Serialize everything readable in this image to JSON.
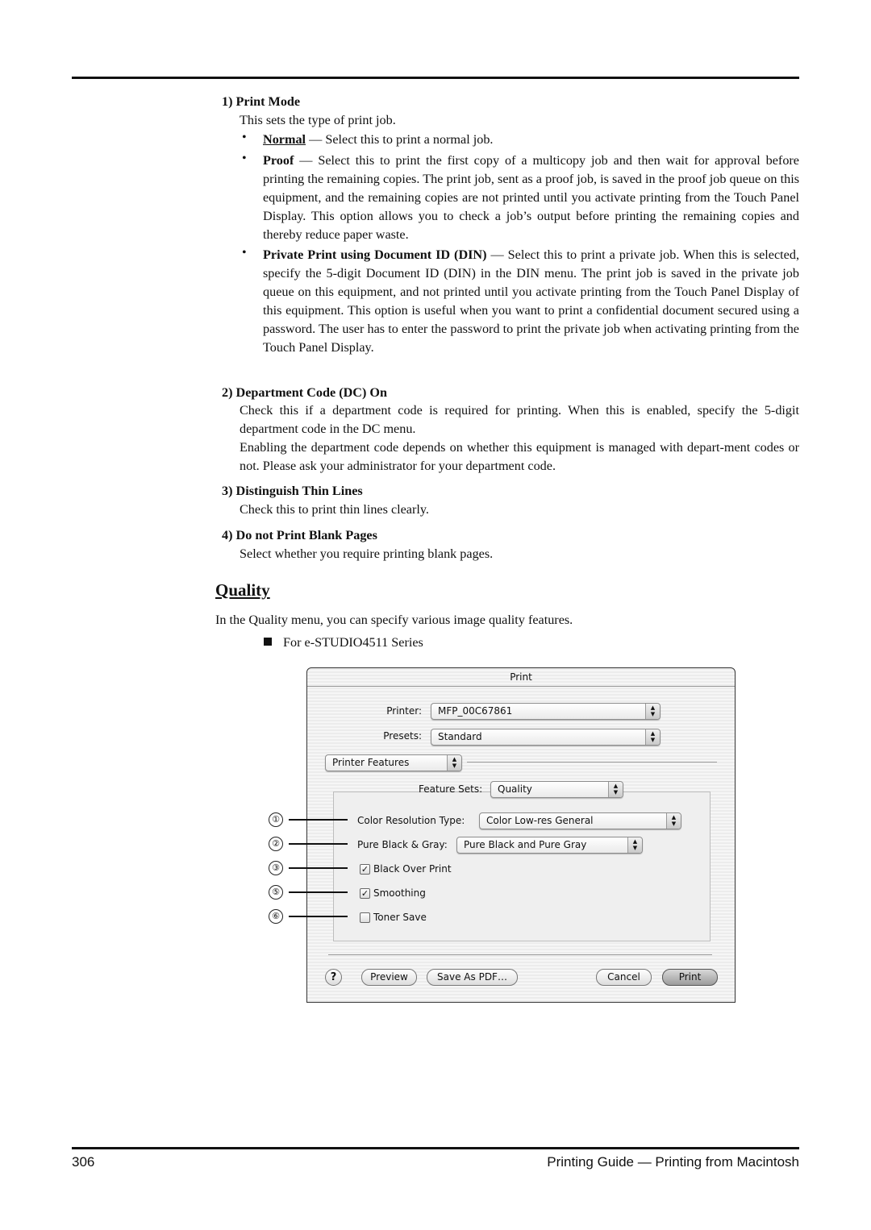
{
  "sections": [
    {
      "heading": "1) Print Mode",
      "intro": "This sets the type of print job.",
      "bullets": [
        {
          "term": "Normal",
          "text": " — Select this to print a normal job."
        },
        {
          "term": "Proof",
          "text": " — Select this to print the first copy of a multicopy job and then wait for approval before printing the remaining copies.  The print job, sent as a proof job, is saved in the proof job queue on this equipment, and the remaining copies are not printed until you activate printing from the Touch Panel Display.  This option allows you to check a job’s output before printing the remaining copies and thereby reduce paper waste."
        },
        {
          "term": "Private Print using Document ID (DIN)",
          "text": " — Select this to print a private job.   When this is selected, specify the 5-digit Document ID (DIN) in the DIN menu.  The print job is saved in the private job queue on this equipment, and not printed until you activate printing from the Touch Panel Display of this equipment.  This option is useful when you want to print a confidential document secured using a password.  The user has to enter the password to print the private job when activating printing from the Touch Panel Display."
        }
      ]
    },
    {
      "heading": "2) Department Code (DC) On",
      "paragraphs": [
        "Check this if a department code is required for printing. When this is enabled, specify the 5-digit department code in the DC menu.",
        "Enabling the department code depends on whether this equipment is managed with depart-ment codes or not.  Please ask your administrator for your department code."
      ]
    },
    {
      "heading": "3) Distinguish Thin Lines",
      "paragraphs": [
        "Check this to print thin lines clearly."
      ]
    },
    {
      "heading": "4) Do not Print Blank Pages",
      "paragraphs": [
        "Select whether you require printing blank pages."
      ]
    }
  ],
  "quality": {
    "title": "Quality",
    "intro": "In the Quality menu, you can specify various image quality features.",
    "series_note": "For e-STUDIO4511 Series"
  },
  "dialog": {
    "title": "Print",
    "printer_label": "Printer:",
    "printer_value": "MFP_00C67861",
    "presets_label": "Presets:",
    "presets_value": "Standard",
    "panel_value": "Printer Features",
    "feature_sets_label": "Feature Sets:",
    "feature_sets_value": "Quality",
    "color_resolution_label": "Color Resolution Type:",
    "color_resolution_value": "Color Low-res General",
    "pure_black_label": "Pure Black & Gray:",
    "pure_black_value": "Pure Black and Pure Gray",
    "checkboxes": [
      {
        "label": "Black Over Print",
        "checked": true
      },
      {
        "label": "Smoothing",
        "checked": true
      },
      {
        "label": "Toner Save",
        "checked": false
      }
    ],
    "help_glyph": "?",
    "buttons": {
      "preview": "Preview",
      "save_pdf": "Save As PDF…",
      "cancel": "Cancel",
      "print": "Print"
    },
    "arrows_glyph": "▲▼",
    "check_glyph": "✓"
  },
  "callouts": [
    "①",
    "②",
    "③",
    "⑤",
    "⑥"
  ],
  "footer": {
    "page_number": "306",
    "title": "Printing Guide — Printing from Macintosh"
  }
}
